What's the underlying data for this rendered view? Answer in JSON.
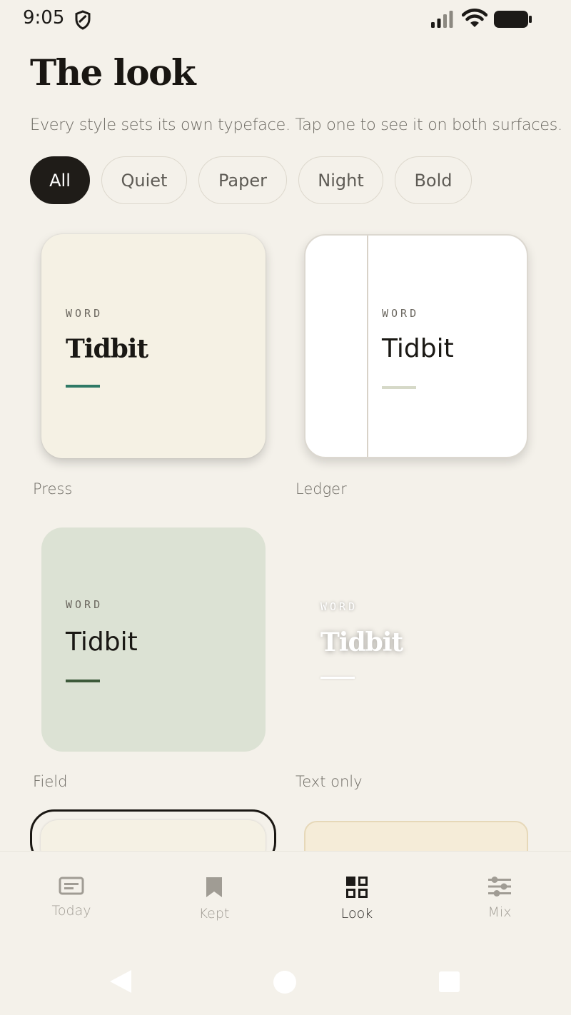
{
  "status_bar": {
    "time": "9:05",
    "icons": [
      "shield-icon",
      "signal-icon",
      "wifi-icon",
      "battery-icon"
    ]
  },
  "header": {
    "title": "The look",
    "subtitle": "Every style sets its own typeface. Tap one to see it on both surfaces."
  },
  "filters": {
    "selected": "All",
    "chips": [
      "All",
      "Quiet",
      "Paper",
      "Night",
      "Bold"
    ]
  },
  "styles": [
    {
      "label": "Press",
      "word_caption": "WORD",
      "word": "Tidbit",
      "accent": "#2f7a66"
    },
    {
      "label": "Ledger",
      "word_caption": "WORD",
      "word": "Tidbit",
      "accent": "#d6d9c8"
    },
    {
      "label": "Field",
      "word_caption": "WORD",
      "word": "Tidbit",
      "accent": "#3d5a3a"
    },
    {
      "label": "Text only",
      "word_caption": "WORD",
      "word": "Tidbit",
      "accent": "#ffffff"
    }
  ],
  "bottom_nav": {
    "active": "Look",
    "items": [
      {
        "label": "Today",
        "icon": "article-icon"
      },
      {
        "label": "Kept",
        "icon": "bookmark-icon"
      },
      {
        "label": "Look",
        "icon": "grid-icon"
      },
      {
        "label": "Mix",
        "icon": "sliders-icon"
      }
    ]
  },
  "colors": {
    "background": "#f4f1ea",
    "ink": "#1c1a17",
    "chip_active": "#1f1c18",
    "muted": "#6d6a63"
  }
}
